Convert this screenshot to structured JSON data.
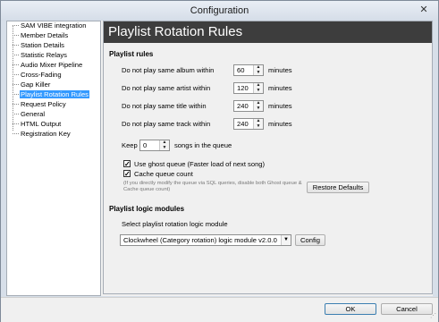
{
  "window": {
    "title": "Configuration",
    "close_glyph": "✕"
  },
  "sidebar": {
    "items": [
      {
        "label": "SAM VIBE integration"
      },
      {
        "label": "Member Details"
      },
      {
        "label": "Station Details"
      },
      {
        "label": "Statistic Relays"
      },
      {
        "label": "Audio Mixer Pipeline"
      },
      {
        "label": "Cross-Fading"
      },
      {
        "label": "Gap Killer"
      },
      {
        "label": "Playlist Rotation Rules",
        "selected": true
      },
      {
        "label": "Request Policy"
      },
      {
        "label": "General"
      },
      {
        "label": "HTML Output"
      },
      {
        "label": "Registration Key"
      }
    ]
  },
  "panel": {
    "title": "Playlist Rotation Rules",
    "playlist_rules": {
      "heading": "Playlist rules",
      "rules": [
        {
          "label": "Do not play same album within",
          "value": "60",
          "unit": "minutes"
        },
        {
          "label": "Do not play same artist within",
          "value": "120",
          "unit": "minutes"
        },
        {
          "label": "Do not play same title within",
          "value": "240",
          "unit": "minutes"
        },
        {
          "label": "Do not play same track within",
          "value": "240",
          "unit": "minutes"
        }
      ],
      "keep": {
        "prefix": "Keep",
        "value": "0",
        "suffix": "songs in the queue"
      },
      "ghost_queue": {
        "label": "Use ghost queue (Faster load of next song)",
        "checked": true
      },
      "cache_queue": {
        "label": "Cache queue count",
        "checked": true
      },
      "hint": "(If you directly modify the queue via SQL queries, disable both Ghost queue & Cache queue count)",
      "restore_button": "Restore Defaults"
    },
    "logic_modules": {
      "heading": "Playlist logic modules",
      "select_label": "Select playlist rotation logic module",
      "selected_module": "Clockwheel (Category rotation) logic module v2.0.0",
      "config_button": "Config"
    }
  },
  "footer": {
    "ok": "OK",
    "cancel": "Cancel"
  },
  "icons": {
    "spin_up": "▲",
    "spin_down": "▼",
    "dropdown": "▼",
    "check": "✓",
    "grip": "⋰"
  }
}
